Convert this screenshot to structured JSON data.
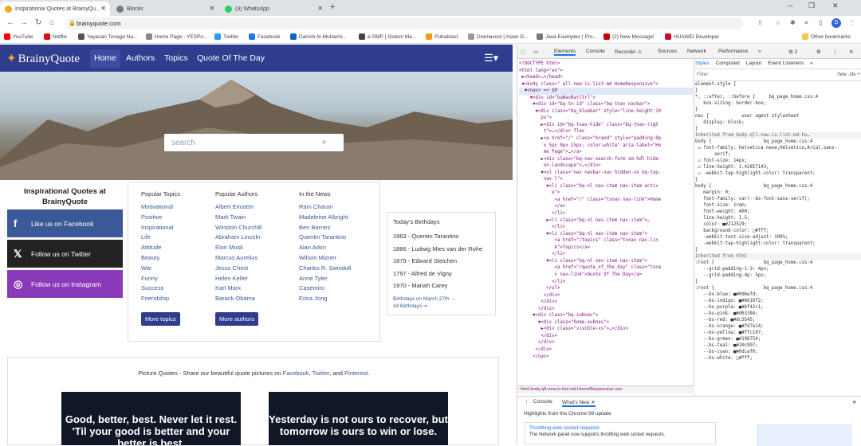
{
  "browser": {
    "tabs": [
      {
        "label": "Inspirational Quotes at BrainyQu...",
        "color": "#f5a623"
      },
      {
        "label": "Blocks",
        "color": "#7a7a7a"
      },
      {
        "label": "(3) WhatsApp",
        "color": "#25d366"
      }
    ],
    "url": "brainyquote.com",
    "profile": "D",
    "bookmarks": [
      {
        "label": "YouTube",
        "color": "#ff0000"
      },
      {
        "label": "Netflix",
        "color": "#e50914"
      },
      {
        "label": "Yayasan Tenaga Na...",
        "color": "#555555"
      },
      {
        "label": "Home Page - YESPo...",
        "color": "#888888"
      },
      {
        "label": "Twitter",
        "color": "#1da1f2"
      },
      {
        "label": "Facebook",
        "color": "#1877f2"
      },
      {
        "label": "Danish Al-Muhaimi...",
        "color": "#0a66c2"
      },
      {
        "label": "e-SMP | Sistem Ma...",
        "color": "#444444"
      },
      {
        "label": "Putrablast",
        "color": "#f39c12"
      },
      {
        "label": "Dramacool | Asian D...",
        "color": "#999999"
      },
      {
        "label": "Java Examples | Pro...",
        "color": "#777777"
      },
      {
        "label": "(2) New Message!",
        "color": "#cc0000"
      },
      {
        "label": "HUAWEI Developer",
        "color": "#cf0a2c"
      }
    ],
    "other_bookmarks": "Other bookmarks"
  },
  "site": {
    "logo": "BrainyQuote",
    "nav": [
      "Home",
      "Authors",
      "Topics",
      "Quote Of The Day"
    ],
    "search_placeholder": "search",
    "iq_title": "Inspirational Quotes at BrainyQuote",
    "social": [
      {
        "label": "Like us on Facebook",
        "icon": "f",
        "color": "#3b5998"
      },
      {
        "label": "Follow us on Twitter",
        "icon": "𝕏",
        "color": "#222222"
      },
      {
        "label": "Follow us on Instagram",
        "icon": "◎",
        "color": "#8a3ab9"
      }
    ],
    "topics": {
      "head": "Popular Topics",
      "items": [
        "Motivational",
        "Positive",
        "Inspirational",
        "Life",
        "Attitude",
        "Beauty",
        "War",
        "Funny",
        "Success",
        "Friendship"
      ],
      "button": "More topics"
    },
    "authors": {
      "head": "Popular Authors",
      "items": [
        "Albert Einstein",
        "Mark Twain",
        "Winston Churchill",
        "Abraham Lincoln",
        "Elon Musk",
        "Marcus Aurelius",
        "Jesus Christ",
        "Helen Keller",
        "Karl Marx",
        "Barack Obama"
      ],
      "button": "More authors"
    },
    "news": {
      "head": "In the News",
      "items": [
        "Ram Charan",
        "Madeleine Albright",
        "Ben Barnes",
        "Quentin Tarantino",
        "Alan Arkin",
        "Wilson Mizner",
        "Charles R. Swindoll",
        "Anne Tyler",
        "Casemiro",
        "Erica Jong"
      ]
    },
    "birthdays": {
      "head": "Today's Birthdays",
      "items": [
        "1963 - Quentin Tarantino",
        "1886 - Ludwig Mies van der Rohe",
        "1879 - Edward Steichen",
        "1797 - Alfred de Vigny",
        "1970 - Mariah Carey"
      ],
      "link1": "Birthdays on March 27th →",
      "link2": "All Birthdays ➞"
    },
    "picture_quotes": {
      "text_pre": "Picture Quotes - Share our beautiful quote pictures on ",
      "fb": "Facebook",
      "sep": ", ",
      "tw": "Twitter",
      "and": ", and ",
      "pin": "Pinterest",
      "end": ".",
      "card1": "Good, better, best. Never let it rest. 'Til your good is better and your better is best.",
      "card2": "Yesterday is not ours to recover, but tomorrow is ours to win or lose."
    }
  },
  "devtools": {
    "tabs": [
      "Elements",
      "Console",
      "Recorder ⚠",
      "Sources",
      "Network",
      "Performance",
      "»"
    ],
    "badges": "⚙ 2",
    "style_tabs": [
      "Styles",
      "Computed",
      "Layout",
      "Event Listeners",
      "»"
    ],
    "filter": "Filter",
    "filter_right": ":hov  .cls  +",
    "breadcrumb": "html   body.qll-new.is-list-md.HomeResponsive   nav",
    "drawer_tabs": [
      "Console",
      "What's New ✕"
    ],
    "drawer_highlight": "Highlights from the Chrome 99 update",
    "drawer_card_title": "Throttling web socket requests",
    "drawer_card_desc": "The Network panel now supports throttling web socket requests.",
    "code_lines": [
      "<!DOCTYPE html>",
      "<html lang=\"en\">",
      " ▶<head>…</head>",
      " ▼<body class=\" qll-new is-list-md HomeResponsive\">",
      "  ▼<nav> == $0",
      "    ▼<div id=\"bqNavBarCtrl\">",
      "     ▼<div id=\"bq-tn-id\" class=\"bq-tnav navbar\">",
      "      ▼<div class=\"bq_bluebar\" style=\"line-height:10",
      "        px\">",
      "        ▶<div id=\"bq-tnav-hide\" class=\"bq-tnav-righ",
      "         t\">…</div> flex",
      "        ▶<a href=\"/\" class=\"brand\" style=\"padding:0p",
      "         x 5px 0px 15px; color:white\" aria-label=\"Ho",
      "         me Page\">…</a>",
      "        ▶<div class=\"bq-nav-search-form sm-hdl hide-",
      "         on-landscape\">…</div>",
      "        ▼<ul class=\"nav navbar-nav hidden-xs bq-top-",
      "         nav-l\">",
      "          ▼<li class=\"bq-nl nav-item nav-item activ",
      "            e\">",
      "             <a href=\"/\" class=\"txnav nav-link\">Home",
      "             </a>",
      "            </li>",
      "          ▶<li class=\"bq-nl nav-item nav-item\">…",
      "            </li>",
      "          ▼<li class=\"bq-nl nav-item nav-item\">",
      "             <a href=\"/topics\" class=\"txnav nav-lin",
      "             k\">Topics</a>",
      "            </li>",
      "          ▼<li class=\"bq-nl nav-item nav-item\">",
      "             <a href=\"/quote_of_the_day\" class=\"txna",
      "             v nav-link\">Quote Of The Day</a>",
      "            </li>",
      "          </ul>",
      "         </div>",
      "        </div>",
      "       </div>",
      "     ▼<div class=\"bq-subnav\">",
      "       ▼<div class=\"home-subnav\">",
      "        ▶<div class=\"visible-xs\">…</div>",
      "        </div>",
      "       </div>",
      "      </div>",
      "     </nav>"
    ],
    "style_lines": [
      "element.style {",
      "}",
      "*, ::after, ::before {     bq_page_home.css:4",
      "   box-sizing: border-box;",
      "}",
      "nav {            user agent stylesheet",
      "   display: block;",
      "}",
      "Inherited from body.qll-new.is-list-md.ho…",
      "body {                   bq_page_home.css:4",
      " ☑ font-family: helvetica neue,Helvetica,Arial,sans-",
      "       serif;",
      " ☑ font-size: 14px;",
      " ☑ line-height: 1.42857143;",
      " ☑ -webkit-tap-highlight-color: transparent;",
      "}",
      "body {                   bq_page_home.css:4",
      "   margin: 0;",
      "   font-family: var(--bs-font-sans-serif);",
      "   font-size: 1rem;",
      "   font-weight: 400;",
      "   line-height: 1.5;",
      "   color: ■#212529;",
      "   background-color: □#fff;",
      "   -webkit-text-size-adjust: 100%;",
      "   -webkit-tap-highlight-color: transparent;",
      "}",
      "Inherited from html",
      ":root {                  bq_page_home.css:4",
      "   --grid-padding-1-3: 4px;",
      "   --grid-padding-4p: 5px;",
      "}",
      ":root {                  bq_page_home.css:4",
      "   --bs-blue: ■#0d6efd;",
      "   --bs-indigo: ■#6610f2;",
      "   --bs-purple: ■#6f42c1;",
      "   --bs-pink: ■#d63384;",
      "   --bs-red: ■#dc3545;",
      "   --bs-orange: ■#fd7e14;",
      "   --bs-yellow: ■#ffc107;",
      "   --bs-green: ■#198754;",
      "   --bs-teal: ■#20c997;",
      "   --bs-cyan: ■#0dcaf0;",
      "   --bs-white: □#fff;"
    ]
  }
}
